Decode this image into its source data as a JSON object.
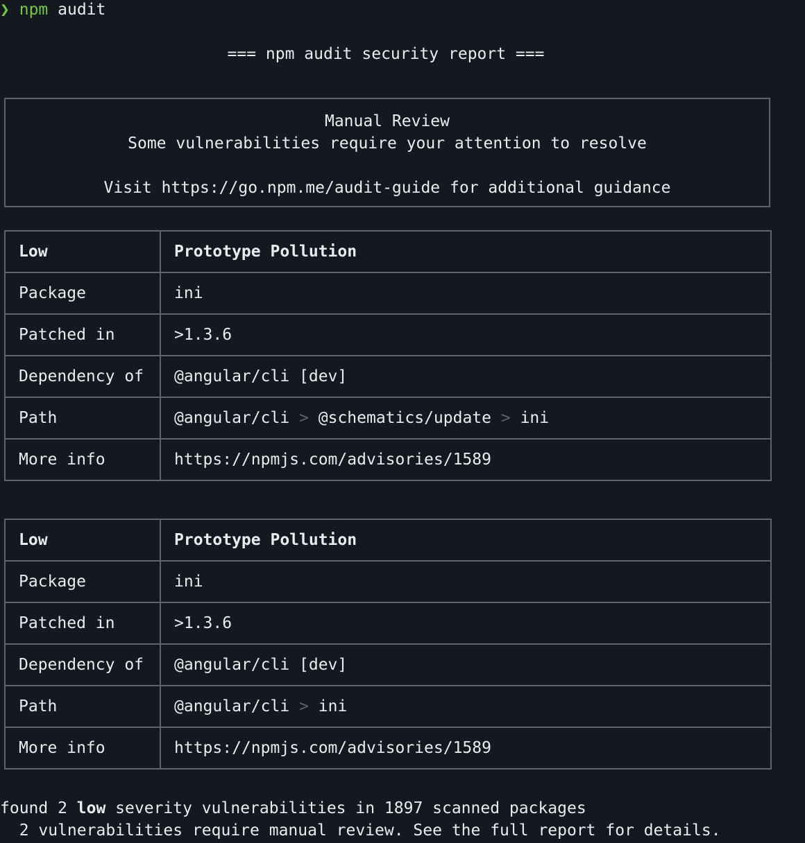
{
  "prompt": {
    "symbol": "❯",
    "command": "npm",
    "argument": "audit"
  },
  "report_title": "=== npm audit security report ===",
  "manual_review": {
    "heading": "Manual Review",
    "line1": "Some vulnerabilities require your attention to resolve",
    "line2": "Visit https://go.npm.me/audit-guide for additional guidance"
  },
  "advisories": [
    {
      "severity": "Low",
      "title": "Prototype Pollution",
      "package_label": "Package",
      "package": "ini",
      "patched_label": "Patched in",
      "patched": ">1.3.6",
      "dependency_label": "Dependency of",
      "dependency": "@angular/cli [dev]",
      "path_label": "Path",
      "path": [
        "@angular/cli",
        "@schematics/update",
        "ini"
      ],
      "path_separator": ">",
      "info_label": "More info",
      "info": "https://npmjs.com/advisories/1589"
    },
    {
      "severity": "Low",
      "title": "Prototype Pollution",
      "package_label": "Package",
      "package": "ini",
      "patched_label": "Patched in",
      "patched": ">1.3.6",
      "dependency_label": "Dependency of",
      "dependency": "@angular/cli [dev]",
      "path_label": "Path",
      "path": [
        "@angular/cli",
        "ini"
      ],
      "path_separator": ">",
      "info_label": "More info",
      "info": "https://npmjs.com/advisories/1589"
    }
  ],
  "summary": {
    "prefix": "found 2 ",
    "severity_word": "low",
    "suffix": " severity vulnerabilities in 1897 scanned packages",
    "line2": "  2 vulnerabilities require manual review. See the full report for details."
  },
  "colors": {
    "background": "#13191f",
    "text": "#e9ecef",
    "prompt_green": "#74c944",
    "border": "#5c636a"
  }
}
